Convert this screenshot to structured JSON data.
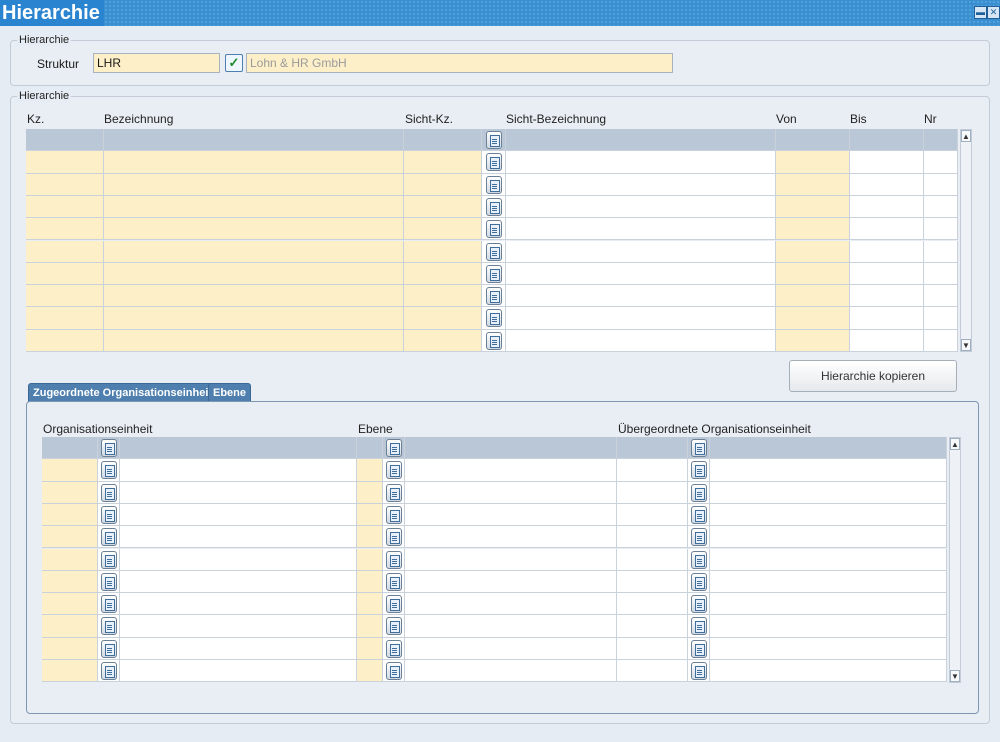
{
  "window": {
    "title": "Hierarchie",
    "minimize_symbol": "▬",
    "close_symbol": "✕"
  },
  "structure_group": {
    "label": "Hierarchie",
    "struktur_label": "Struktur",
    "struktur_value": "LHR",
    "struktur_check_symbol": "✓",
    "struktur_description": "Lohn & HR GmbH"
  },
  "hierarchy_group": {
    "label": "Hierarchie",
    "columns": [
      "Kz.",
      "Bezeichnung",
      "Sicht-Kz.",
      "Sicht-Bezeichnung",
      "Von",
      "Bis",
      "Nr"
    ],
    "row_count": 10,
    "copy_button_label": "Hierarchie kopieren"
  },
  "tabs": [
    {
      "label": "Zugeordnete Organisationseinheit",
      "active": true
    },
    {
      "label": "Ebene",
      "active": false
    }
  ],
  "org_table": {
    "columns": [
      "Organisationseinheit",
      "Ebene",
      "Übergeordnete Organisationseinheit"
    ],
    "row_count": 11
  },
  "scrollbar": {
    "up_symbol": "▲",
    "down_symbol": "▼"
  },
  "colors": {
    "titlebar": "#2b84cf",
    "field_yellow": "#fdf0c9",
    "selected_row": "#b9c7d7",
    "tab_active": "#4f7fae"
  }
}
